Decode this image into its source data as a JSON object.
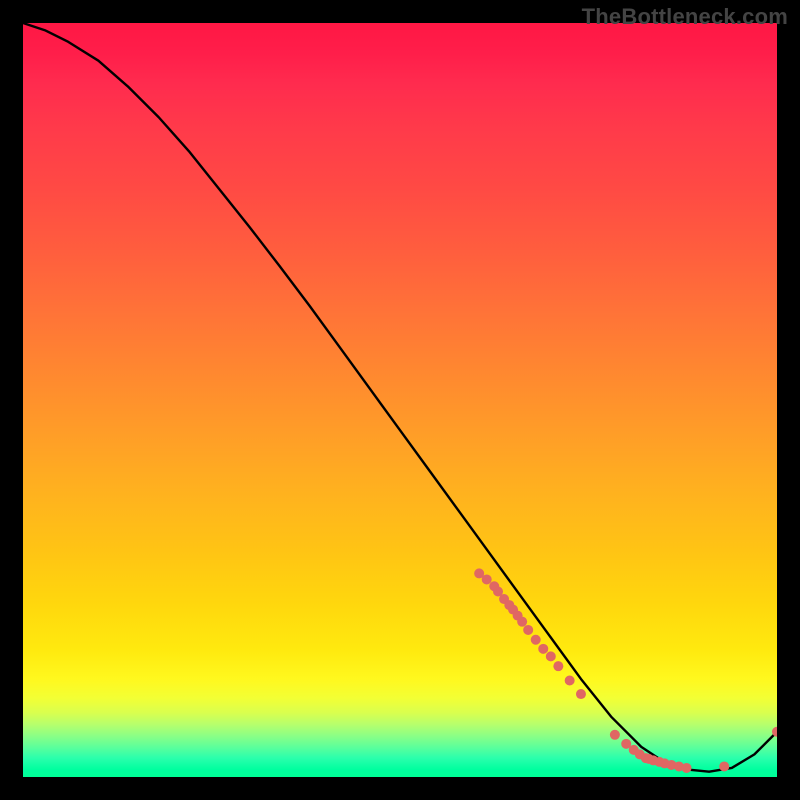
{
  "watermark": "TheBottleneck.com",
  "chart_data": {
    "type": "line",
    "title": "",
    "xlabel": "",
    "ylabel": "",
    "xlim": [
      0,
      100
    ],
    "ylim": [
      0,
      100
    ],
    "grid": false,
    "legend": false,
    "series": [
      {
        "name": "curve",
        "color": "#000000",
        "x": [
          0,
          3,
          6,
          10,
          14,
          18,
          22,
          26,
          30,
          34,
          38,
          42,
          46,
          50,
          54,
          58,
          62,
          66,
          70,
          74,
          78,
          82,
          85,
          88,
          91,
          94,
          97,
          100
        ],
        "y": [
          100,
          99,
          97.5,
          95,
          91.5,
          87.5,
          83,
          78,
          73,
          67.8,
          62.5,
          57,
          51.5,
          46,
          40.5,
          35,
          29.5,
          24,
          18.5,
          13,
          8,
          4,
          2,
          1,
          0.7,
          1.2,
          3,
          6
        ]
      }
    ],
    "points": {
      "name": "markers",
      "color": "#e06763",
      "radius_px": 5,
      "x": [
        60.5,
        61.5,
        62.5,
        63.0,
        63.8,
        64.5,
        65.0,
        65.6,
        66.2,
        67.0,
        68.0,
        69.0,
        70.0,
        71.0,
        72.5,
        74.0,
        78.5,
        80.0,
        81.0,
        81.8,
        82.6,
        83.0,
        83.6,
        84.4,
        85.1,
        86.0,
        87.0,
        88.0,
        93.0,
        100.0
      ],
      "y": [
        27.0,
        26.2,
        25.3,
        24.6,
        23.6,
        22.8,
        22.2,
        21.4,
        20.6,
        19.5,
        18.2,
        17.0,
        16.0,
        14.7,
        12.8,
        11.0,
        5.6,
        4.4,
        3.6,
        3.0,
        2.5,
        2.4,
        2.2,
        2.0,
        1.8,
        1.6,
        1.4,
        1.2,
        1.4,
        6.0
      ]
    }
  }
}
